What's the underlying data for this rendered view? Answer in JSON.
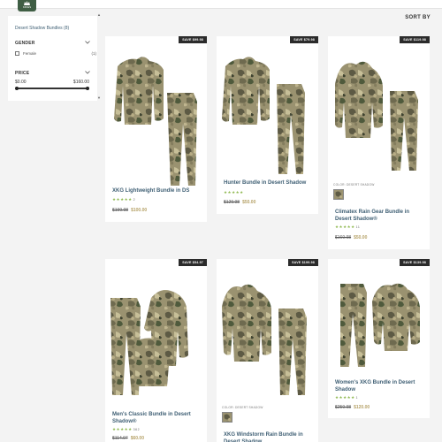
{
  "header": {
    "logo_text": "KINGS",
    "sort_label": "SORT BY"
  },
  "sidebar": {
    "breadcrumb": "Desert Shadow Bundles (8)",
    "gender": {
      "title": "GENDER",
      "options": [
        {
          "label": "Female",
          "count": "(1)",
          "checked": false
        }
      ]
    },
    "price": {
      "title": "PRICE",
      "min_label": "$0.00",
      "max_label": "$160.00",
      "range_low_fraction": 0,
      "range_high_fraction": 1
    }
  },
  "products": [
    {
      "name": "XKG Lightweight Bundle in DS",
      "badge": "SAVE $99.98",
      "old_price": "$199.98",
      "new_price": "$100.00",
      "review_count": "2",
      "color_label": "",
      "rating": 5
    },
    {
      "name": "Hunter Bundle in Desert Shadow",
      "badge": "SAVE $79.98",
      "old_price": "$129.98",
      "new_price": "$50.00",
      "review_count": "",
      "color_label": "",
      "rating": 5
    },
    {
      "name": "Climatex Rain Gear Bundle in Desert Shadow®",
      "badge": "SAVE $119.98",
      "old_price": "$169.98",
      "new_price": "$50.00",
      "review_count": "11",
      "color_label": "COLOR: DESERT SHADOW",
      "rating": 5
    },
    {
      "name": "Men's Classic Bundle in Desert Shadow®",
      "badge": "SAVE $54.97",
      "old_price": "$114.97",
      "new_price": "$60.00",
      "review_count": "362",
      "color_label": "",
      "rating": 5
    },
    {
      "name": "XKG Windstorm Rain Bundle in Desert Shadow",
      "badge": "SAVE $199.98",
      "old_price": "",
      "new_price": "",
      "review_count": "",
      "color_label": "COLOR: DESERT SHADOW",
      "rating": 0
    },
    {
      "name": "Women's XKG Bundle in Desert Shadow",
      "badge": "SAVE $139.98",
      "old_price": "$259.98",
      "new_price": "$120.00",
      "review_count": "1",
      "color_label": "",
      "rating": 5
    }
  ],
  "colors": {
    "accent_green": "#3f5e44",
    "link_blue": "#3f5f74",
    "star_green": "#8eb84f",
    "sale_gold": "#b7a36a",
    "camo_base": "#8a8467"
  }
}
